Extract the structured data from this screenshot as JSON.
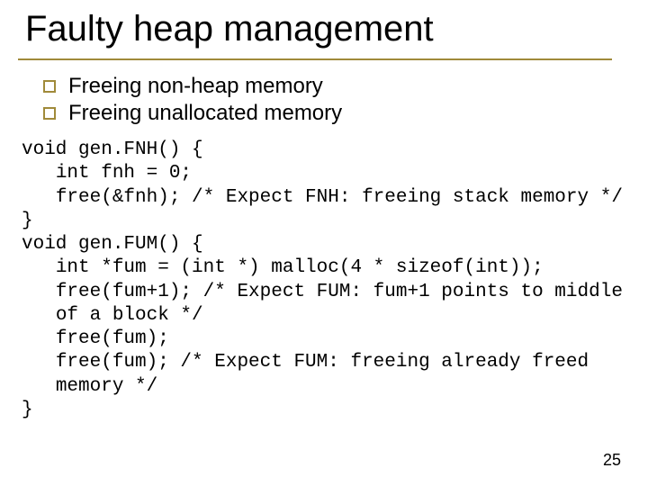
{
  "title": "Faulty heap management",
  "bullets": [
    "Freeing non-heap memory",
    "Freeing unallocated memory"
  ],
  "code": "void gen.FNH() {\n   int fnh = 0;\n   free(&fnh); /* Expect FNH: freeing stack memory */\n}\nvoid gen.FUM() {\n   int *fum = (int *) malloc(4 * sizeof(int));\n   free(fum+1); /* Expect FUM: fum+1 points to middle\n   of a block */\n   free(fum);\n   free(fum); /* Expect FUM: freeing already freed\n   memory */\n}",
  "slide_number": "25"
}
